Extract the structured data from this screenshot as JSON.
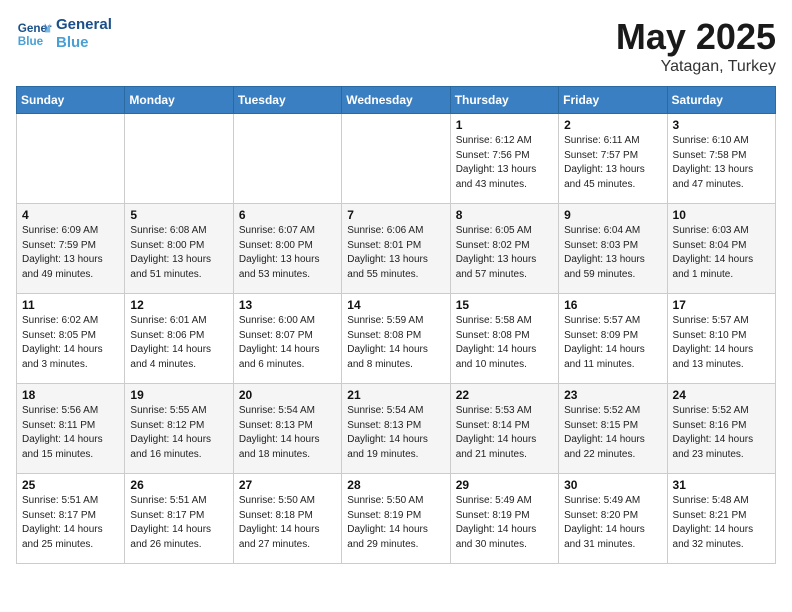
{
  "header": {
    "logo_line1": "General",
    "logo_line2": "Blue",
    "title": "May 2025",
    "subtitle": "Yatagan, Turkey"
  },
  "weekdays": [
    "Sunday",
    "Monday",
    "Tuesday",
    "Wednesday",
    "Thursday",
    "Friday",
    "Saturday"
  ],
  "weeks": [
    [
      {
        "day": "",
        "info": ""
      },
      {
        "day": "",
        "info": ""
      },
      {
        "day": "",
        "info": ""
      },
      {
        "day": "",
        "info": ""
      },
      {
        "day": "1",
        "info": "Sunrise: 6:12 AM\nSunset: 7:56 PM\nDaylight: 13 hours\nand 43 minutes."
      },
      {
        "day": "2",
        "info": "Sunrise: 6:11 AM\nSunset: 7:57 PM\nDaylight: 13 hours\nand 45 minutes."
      },
      {
        "day": "3",
        "info": "Sunrise: 6:10 AM\nSunset: 7:58 PM\nDaylight: 13 hours\nand 47 minutes."
      }
    ],
    [
      {
        "day": "4",
        "info": "Sunrise: 6:09 AM\nSunset: 7:59 PM\nDaylight: 13 hours\nand 49 minutes."
      },
      {
        "day": "5",
        "info": "Sunrise: 6:08 AM\nSunset: 8:00 PM\nDaylight: 13 hours\nand 51 minutes."
      },
      {
        "day": "6",
        "info": "Sunrise: 6:07 AM\nSunset: 8:00 PM\nDaylight: 13 hours\nand 53 minutes."
      },
      {
        "day": "7",
        "info": "Sunrise: 6:06 AM\nSunset: 8:01 PM\nDaylight: 13 hours\nand 55 minutes."
      },
      {
        "day": "8",
        "info": "Sunrise: 6:05 AM\nSunset: 8:02 PM\nDaylight: 13 hours\nand 57 minutes."
      },
      {
        "day": "9",
        "info": "Sunrise: 6:04 AM\nSunset: 8:03 PM\nDaylight: 13 hours\nand 59 minutes."
      },
      {
        "day": "10",
        "info": "Sunrise: 6:03 AM\nSunset: 8:04 PM\nDaylight: 14 hours\nand 1 minute."
      }
    ],
    [
      {
        "day": "11",
        "info": "Sunrise: 6:02 AM\nSunset: 8:05 PM\nDaylight: 14 hours\nand 3 minutes."
      },
      {
        "day": "12",
        "info": "Sunrise: 6:01 AM\nSunset: 8:06 PM\nDaylight: 14 hours\nand 4 minutes."
      },
      {
        "day": "13",
        "info": "Sunrise: 6:00 AM\nSunset: 8:07 PM\nDaylight: 14 hours\nand 6 minutes."
      },
      {
        "day": "14",
        "info": "Sunrise: 5:59 AM\nSunset: 8:08 PM\nDaylight: 14 hours\nand 8 minutes."
      },
      {
        "day": "15",
        "info": "Sunrise: 5:58 AM\nSunset: 8:08 PM\nDaylight: 14 hours\nand 10 minutes."
      },
      {
        "day": "16",
        "info": "Sunrise: 5:57 AM\nSunset: 8:09 PM\nDaylight: 14 hours\nand 11 minutes."
      },
      {
        "day": "17",
        "info": "Sunrise: 5:57 AM\nSunset: 8:10 PM\nDaylight: 14 hours\nand 13 minutes."
      }
    ],
    [
      {
        "day": "18",
        "info": "Sunrise: 5:56 AM\nSunset: 8:11 PM\nDaylight: 14 hours\nand 15 minutes."
      },
      {
        "day": "19",
        "info": "Sunrise: 5:55 AM\nSunset: 8:12 PM\nDaylight: 14 hours\nand 16 minutes."
      },
      {
        "day": "20",
        "info": "Sunrise: 5:54 AM\nSunset: 8:13 PM\nDaylight: 14 hours\nand 18 minutes."
      },
      {
        "day": "21",
        "info": "Sunrise: 5:54 AM\nSunset: 8:13 PM\nDaylight: 14 hours\nand 19 minutes."
      },
      {
        "day": "22",
        "info": "Sunrise: 5:53 AM\nSunset: 8:14 PM\nDaylight: 14 hours\nand 21 minutes."
      },
      {
        "day": "23",
        "info": "Sunrise: 5:52 AM\nSunset: 8:15 PM\nDaylight: 14 hours\nand 22 minutes."
      },
      {
        "day": "24",
        "info": "Sunrise: 5:52 AM\nSunset: 8:16 PM\nDaylight: 14 hours\nand 23 minutes."
      }
    ],
    [
      {
        "day": "25",
        "info": "Sunrise: 5:51 AM\nSunset: 8:17 PM\nDaylight: 14 hours\nand 25 minutes."
      },
      {
        "day": "26",
        "info": "Sunrise: 5:51 AM\nSunset: 8:17 PM\nDaylight: 14 hours\nand 26 minutes."
      },
      {
        "day": "27",
        "info": "Sunrise: 5:50 AM\nSunset: 8:18 PM\nDaylight: 14 hours\nand 27 minutes."
      },
      {
        "day": "28",
        "info": "Sunrise: 5:50 AM\nSunset: 8:19 PM\nDaylight: 14 hours\nand 29 minutes."
      },
      {
        "day": "29",
        "info": "Sunrise: 5:49 AM\nSunset: 8:19 PM\nDaylight: 14 hours\nand 30 minutes."
      },
      {
        "day": "30",
        "info": "Sunrise: 5:49 AM\nSunset: 8:20 PM\nDaylight: 14 hours\nand 31 minutes."
      },
      {
        "day": "31",
        "info": "Sunrise: 5:48 AM\nSunset: 8:21 PM\nDaylight: 14 hours\nand 32 minutes."
      }
    ]
  ]
}
